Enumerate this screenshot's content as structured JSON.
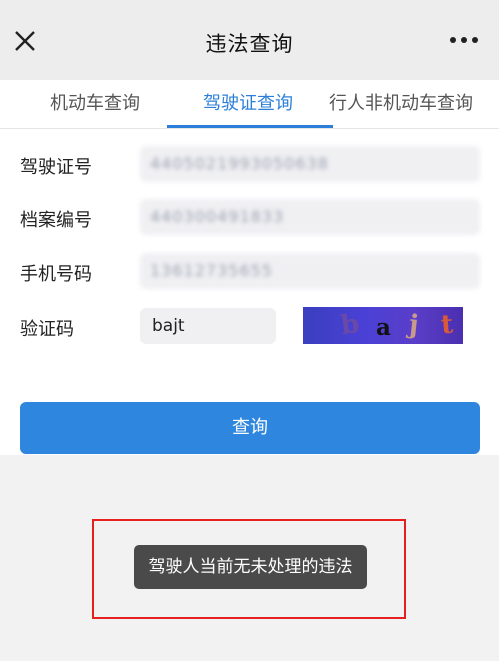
{
  "header": {
    "title": "违法查询",
    "close_icon": "close-icon",
    "more_icon": "more-icon"
  },
  "tabs": [
    {
      "label": "机动车查询",
      "active": false
    },
    {
      "label": "驾驶证查询",
      "active": true
    },
    {
      "label": "行人非机动车查询",
      "active": false
    }
  ],
  "form": {
    "license_number": {
      "label": "驾驶证号",
      "value": "4405021993050638"
    },
    "file_number": {
      "label": "档案编号",
      "value": "440300491833"
    },
    "phone": {
      "label": "手机号码",
      "value": "13612735655"
    },
    "captcha": {
      "label": "验证码",
      "value": "bajt",
      "image_text": [
        "b",
        "a",
        "j",
        "t"
      ]
    }
  },
  "actions": {
    "query_label": "查询"
  },
  "toast": {
    "message": "驾驶人当前无未处理的违法"
  },
  "colors": {
    "accent": "#2b7fd8",
    "button": "#2f86de",
    "highlight_border": "#e5201f"
  }
}
